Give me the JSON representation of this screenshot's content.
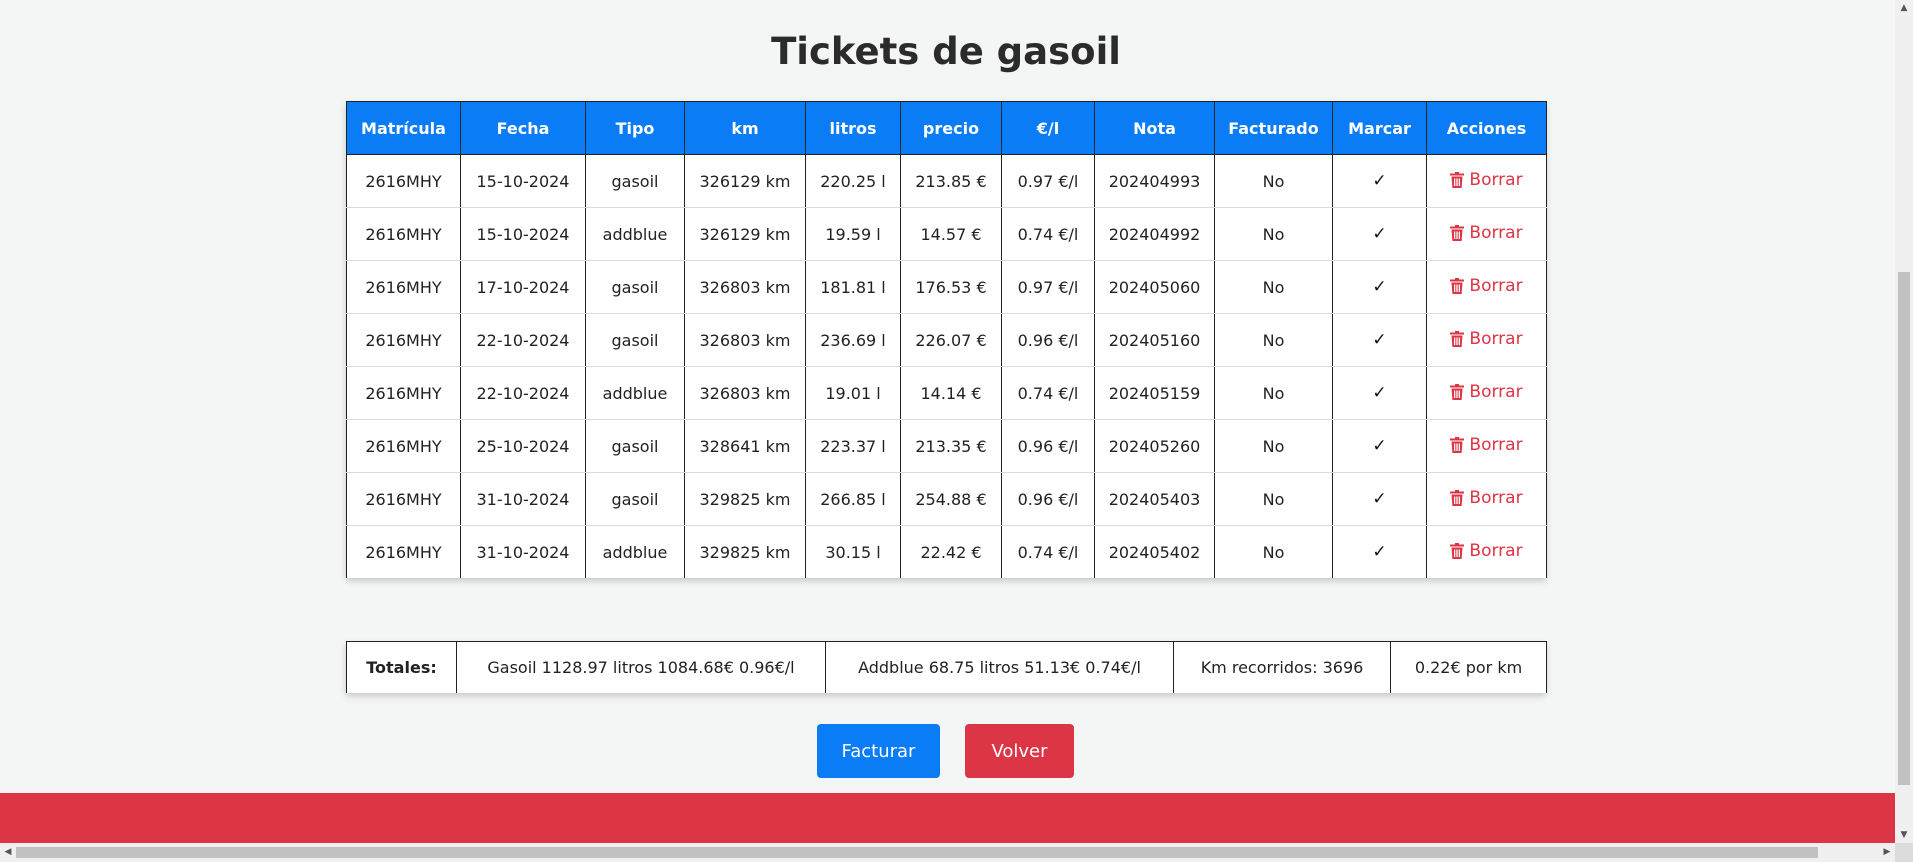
{
  "page": {
    "title": "Tickets de gasoil"
  },
  "table": {
    "headers": [
      "Matrícula",
      "Fecha",
      "Tipo",
      "km",
      "litros",
      "precio",
      "€/l",
      "Nota",
      "Facturado",
      "Marcar",
      "Acciones"
    ],
    "rows": [
      {
        "matricula": "2616MHY",
        "fecha": "15-10-2024",
        "tipo": "gasoil",
        "km": "326129 km",
        "litros": "220.25 l",
        "precio": "213.85 €",
        "eurol": "0.97 €/l",
        "nota": "202404993",
        "facturado": "No",
        "marcar": "✓",
        "accion": "Borrar"
      },
      {
        "matricula": "2616MHY",
        "fecha": "15-10-2024",
        "tipo": "addblue",
        "km": "326129 km",
        "litros": "19.59 l",
        "precio": "14.57 €",
        "eurol": "0.74 €/l",
        "nota": "202404992",
        "facturado": "No",
        "marcar": "✓",
        "accion": "Borrar"
      },
      {
        "matricula": "2616MHY",
        "fecha": "17-10-2024",
        "tipo": "gasoil",
        "km": "326803 km",
        "litros": "181.81 l",
        "precio": "176.53 €",
        "eurol": "0.97 €/l",
        "nota": "202405060",
        "facturado": "No",
        "marcar": "✓",
        "accion": "Borrar"
      },
      {
        "matricula": "2616MHY",
        "fecha": "22-10-2024",
        "tipo": "gasoil",
        "km": "326803 km",
        "litros": "236.69 l",
        "precio": "226.07 €",
        "eurol": "0.96 €/l",
        "nota": "202405160",
        "facturado": "No",
        "marcar": "✓",
        "accion": "Borrar"
      },
      {
        "matricula": "2616MHY",
        "fecha": "22-10-2024",
        "tipo": "addblue",
        "km": "326803 km",
        "litros": "19.01 l",
        "precio": "14.14 €",
        "eurol": "0.74 €/l",
        "nota": "202405159",
        "facturado": "No",
        "marcar": "✓",
        "accion": "Borrar"
      },
      {
        "matricula": "2616MHY",
        "fecha": "25-10-2024",
        "tipo": "gasoil",
        "km": "328641 km",
        "litros": "223.37 l",
        "precio": "213.35 €",
        "eurol": "0.96 €/l",
        "nota": "202405260",
        "facturado": "No",
        "marcar": "✓",
        "accion": "Borrar"
      },
      {
        "matricula": "2616MHY",
        "fecha": "31-10-2024",
        "tipo": "gasoil",
        "km": "329825 km",
        "litros": "266.85 l",
        "precio": "254.88 €",
        "eurol": "0.96 €/l",
        "nota": "202405403",
        "facturado": "No",
        "marcar": "✓",
        "accion": "Borrar"
      },
      {
        "matricula": "2616MHY",
        "fecha": "31-10-2024",
        "tipo": "addblue",
        "km": "329825 km",
        "litros": "30.15 l",
        "precio": "22.42 €",
        "eurol": "0.74 €/l",
        "nota": "202405402",
        "facturado": "No",
        "marcar": "✓",
        "accion": "Borrar"
      }
    ]
  },
  "totals": {
    "label": "Totales:",
    "gasoil": "Gasoil 1128.97 litros 1084.68€ 0.96€/l",
    "addblue": "Addblue 68.75 litros 51.13€ 0.74€/l",
    "km": "Km recorridos: 3696",
    "per_km": "0.22€ por km"
  },
  "buttons": {
    "facturar": "Facturar",
    "volver": "Volver"
  },
  "icons": {
    "delete": "trash-icon",
    "mark": "check-icon"
  },
  "colors": {
    "primary": "#0a7cf5",
    "danger": "#dc3545",
    "background": "#f4f5f5"
  }
}
